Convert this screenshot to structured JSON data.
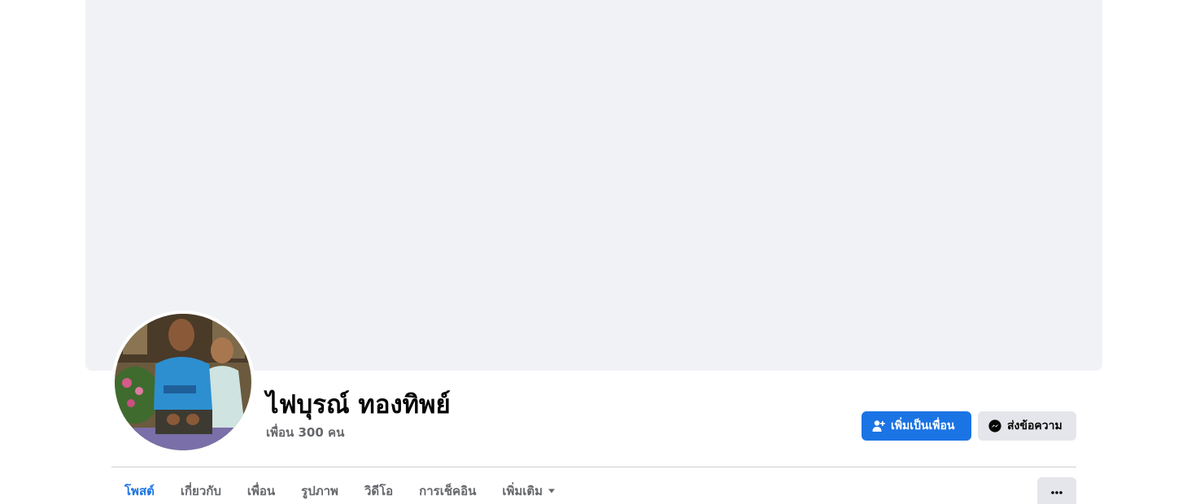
{
  "profile": {
    "name": "ไฟบุรณ์ ทองทิพย์",
    "friends_count_text": "เพื่อน 300 คน",
    "avatar_icon": "profile-photo"
  },
  "actions": {
    "add_friend_label": "เพิ่มเป็นเพื่อน",
    "add_friend_icon": "person-add-icon",
    "message_label": "ส่งข้อความ",
    "message_icon": "messenger-icon",
    "more_icon": "ellipsis-icon"
  },
  "tabs": [
    {
      "label": "โพสต์",
      "active": true
    },
    {
      "label": "เกี่ยวกับ",
      "active": false
    },
    {
      "label": "เพื่อน",
      "active": false
    },
    {
      "label": "รูปภาพ",
      "active": false
    },
    {
      "label": "วิดีโอ",
      "active": false
    },
    {
      "label": "การเช็คอิน",
      "active": false
    },
    {
      "label": "เพิ่มเติม",
      "active": false
    }
  ],
  "colors": {
    "accent": "#1b74e4",
    "cover_bg": "#f0f2f5",
    "button_gray": "#e4e6eb",
    "secondary_text": "#65676b"
  }
}
